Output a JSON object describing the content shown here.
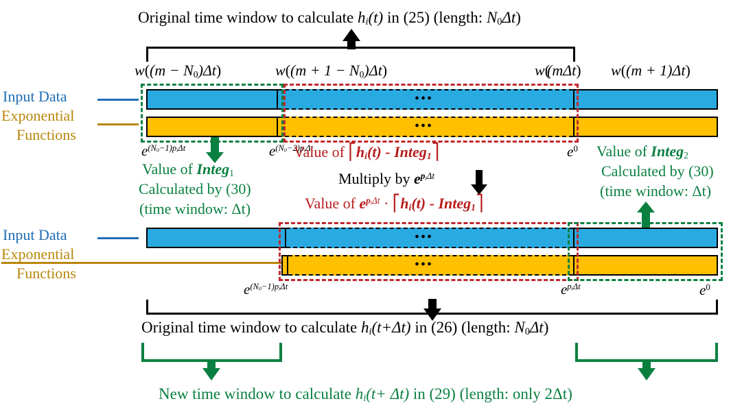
{
  "figure": {
    "title_top": "Original time window to calculate h_i(t) in (25) (length: N_0Δt)",
    "title_bottom": "Original time window to calculate h_i(t+Δt) in (26) (length: N_0Δt)",
    "title_new": "New time window to calculate h_i(t+ Δt) in (29) (length: only 2Δt)"
  },
  "top_bracket_label": {
    "p1": "Original time window to calculate ",
    "h": "h",
    "hsub": "i",
    "p2": "(t)",
    "p3": " in (25) (length: ",
    "n": "N",
    "nsub": "0",
    "dt": "Δt",
    "p4": ")"
  },
  "bottom_bracket_label": {
    "p1": "Original time window to calculate ",
    "h": "h",
    "hsub": "i",
    "p2": "(t+Δt)",
    "p3": " in (26) (length: ",
    "n": "N",
    "nsub": "0",
    "dt": "Δt",
    "p4": ")"
  },
  "new_window_label": {
    "p1": "New time window to calculate ",
    "h": "h",
    "hsub": "i",
    "p2": "(t+ Δt)",
    "p3": " in (29) (length: only 2Δt)"
  },
  "sample_labels": {
    "w1": {
      "w": "w",
      "inner": "(m − N",
      "sub": "0",
      "tail": ")Δt"
    },
    "w2": {
      "w": "w",
      "inner": "(m + 1 − N",
      "sub": "0",
      "tail": ")Δt"
    },
    "w3": {
      "w": "w",
      "inner": "(mΔt"
    },
    "w4": {
      "w": "w",
      "inner": "(m + 1)Δt"
    }
  },
  "legend": {
    "input_data": "Input Data",
    "exponential_line1": "Exponential",
    "exponential_line2": "Functions",
    "input_color": "#1f6eb5",
    "exponential_color": "#b8860b",
    "bar_input_color": "#29abe2",
    "bar_exponential_color": "#ffc000"
  },
  "exponents_row1": {
    "e1": {
      "e": "e",
      "exp_pre": "(N",
      "exp_sub": "0",
      "exp_post": "−1)p",
      "exp_sub2": "i",
      "exp_tail": "Δt"
    },
    "e2": {
      "e": "e",
      "exp_pre": "(N",
      "exp_sub": "0",
      "exp_post": "−2)p",
      "exp_sub2": "i",
      "exp_tail": "Δt"
    },
    "e3": {
      "e": "e",
      "exp": "0"
    }
  },
  "exponents_row2": {
    "e1": {
      "e": "e",
      "exp_pre": "(N",
      "exp_sub": "0",
      "exp_post": "−1)p",
      "exp_sub2": "i",
      "exp_tail": "Δt"
    },
    "e2": {
      "e": "e",
      "exp_pre": "p",
      "exp_sub": "i",
      "exp_tail": "Δt"
    },
    "e3": {
      "e": "e",
      "exp": "0"
    }
  },
  "annotations": {
    "integ1": {
      "line1_a": "Value of ",
      "line1_b": "Integ",
      "line1_sub": "1",
      "line2": "Calculated by (30)",
      "line3": "(time window: Δt)",
      "color": "#0a8040"
    },
    "integ2": {
      "line1_a": "Value of ",
      "line1_b": "Integ",
      "line1_sub": "2",
      "line2": "Calculated by (30)",
      "line3": "(time window: Δt)",
      "color": "#0a8040"
    },
    "value_of_1": {
      "pre": "Value of  ",
      "lb": "⎡",
      "h": "h",
      "hsub": "i",
      "paren": "(t)",
      "minus": " - ",
      "integ": "Integ",
      "isub": "1",
      "rb": "⎤",
      "color": "#b81c1c"
    },
    "multiply": {
      "text": "Multiply by ",
      "e": "e",
      "exp_pre": "p",
      "exp_sub": "i",
      "exp_tail": "Δt",
      "color": "#000000"
    },
    "value_of_2": {
      "pre": "Value of  ",
      "e": "e",
      "exp_pre": "p",
      "exp_sub": "i",
      "exp_tail": "Δt",
      "dot": " · ",
      "h": "h",
      "hsub": "i",
      "paren": "(t)",
      "minus": " - ",
      "integ": "Integ",
      "isub": "1",
      "color": "#b81c1c"
    }
  },
  "ellipsis": "•••",
  "colors": {
    "green": "#0a8040",
    "red_dash": "#c1272d",
    "red_text": "#b81c1c",
    "black": "#000000"
  }
}
